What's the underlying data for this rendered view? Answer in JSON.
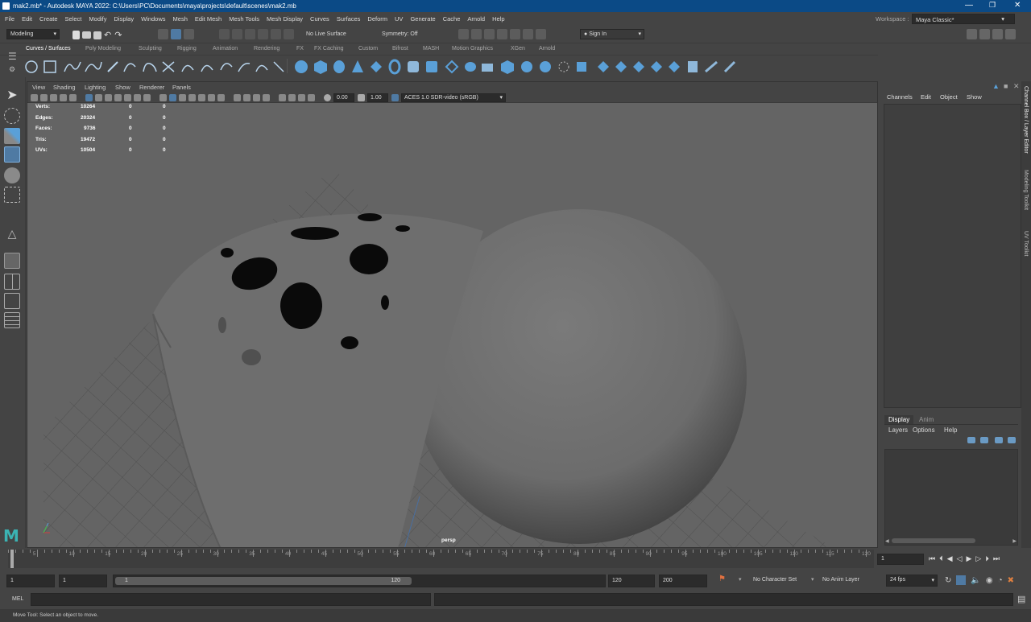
{
  "window": {
    "title": "mak2.mb* - Autodesk MAYA 2022: C:\\Users\\PC\\Documents\\maya\\projects\\default\\scenes\\mak2.mb"
  },
  "menu": [
    "File",
    "Edit",
    "Create",
    "Select",
    "Modify",
    "Display",
    "Windows",
    "Mesh",
    "Edit Mesh",
    "Mesh Tools",
    "Mesh Display",
    "Curves",
    "Surfaces",
    "Deform",
    "UV",
    "Generate",
    "Cache",
    "Arnold",
    "Help"
  ],
  "workspace": {
    "label": "Workspace :",
    "value": "Maya Classic*"
  },
  "statusline": {
    "menuset": "Modeling",
    "live_surface": "No Live Surface",
    "symmetry": "Symmetry: Off",
    "sign_in": "Sign In"
  },
  "shelf_tabs": [
    "Curves / Surfaces",
    "Poly Modeling",
    "Sculpting",
    "Rigging",
    "Animation",
    "Rendering",
    "FX",
    "FX Caching",
    "Custom",
    "Bifrost",
    "MASH",
    "Motion Graphics",
    "XGen",
    "Arnold"
  ],
  "viewport": {
    "menu": [
      "View",
      "Shading",
      "Lighting",
      "Show",
      "Renderer",
      "Panels"
    ],
    "exposure": "0.00",
    "gamma": "1.00",
    "color_space": "ACES 1.0 SDR-video (sRGB)",
    "camera_label": "persp",
    "hud": [
      {
        "label": "Verts:",
        "v1": "10264",
        "v2": "0",
        "v3": "0"
      },
      {
        "label": "Edges:",
        "v1": "20324",
        "v2": "0",
        "v3": "0"
      },
      {
        "label": "Faces:",
        "v1": "9736",
        "v2": "0",
        "v3": "0"
      },
      {
        "label": "Tris:",
        "v1": "19472",
        "v2": "0",
        "v3": "0"
      },
      {
        "label": "UVs:",
        "v1": "10504",
        "v2": "0",
        "v3": "0"
      }
    ]
  },
  "channel_box": {
    "menu": [
      "Channels",
      "Edit",
      "Object",
      "Show"
    ]
  },
  "layer_editor": {
    "tabs": [
      "Display",
      "Anim"
    ],
    "menu": [
      "Layers",
      "Options",
      "Help"
    ]
  },
  "side_tabs": [
    "Channel Box / Layer Editor",
    "Modeling Toolkit",
    "UV Toolkit"
  ],
  "timeline": {
    "ticks": [
      "5",
      "10",
      "15",
      "20",
      "25",
      "30",
      "35",
      "40",
      "45",
      "50",
      "55",
      "60",
      "65",
      "70",
      "75",
      "80",
      "85",
      "90",
      "95",
      "100",
      "105",
      "110",
      "115",
      "120"
    ],
    "current_frame": "1"
  },
  "range": {
    "start": "1",
    "playback_start": "1",
    "slider_start": "1",
    "slider_end": "120",
    "end": "120",
    "anim_end": "200",
    "character_set": "No Character Set",
    "anim_layer": "No Anim Layer",
    "fps": "24 fps"
  },
  "command": {
    "label": "MEL"
  },
  "help_line": "Move Tool: Select an object to move.",
  "colors": {
    "accent": "#5aa0d8",
    "title_bar": "#0b4a86",
    "active_tool": "#4f7aa3"
  }
}
